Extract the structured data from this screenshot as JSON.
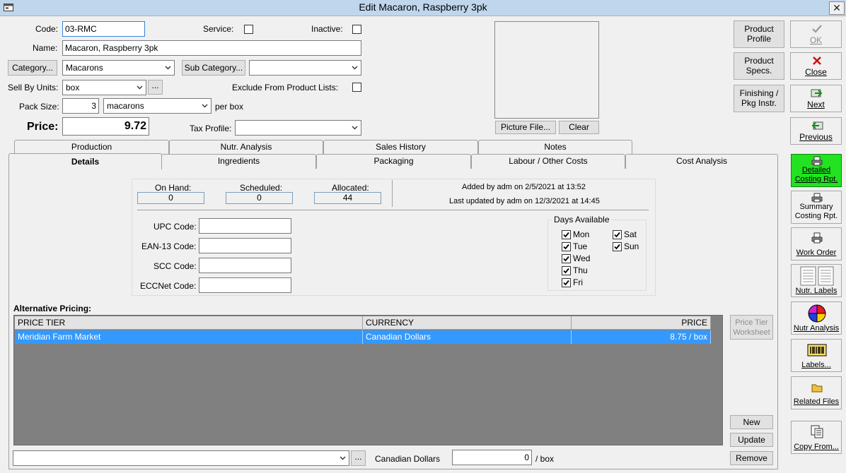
{
  "window": {
    "title": "Edit Macaron, Raspberry 3pk",
    "close_glyph": "✕"
  },
  "form": {
    "code_label": "Code:",
    "code_value": "03-RMC",
    "service_label": "Service:",
    "inactive_label": "Inactive:",
    "name_label": "Name:",
    "name_value": "Macaron, Raspberry 3pk",
    "category_button": "Category...",
    "category_value": "Macarons",
    "subcategory_button": "Sub Category...",
    "subcategory_value": "",
    "sell_by_label": "Sell By Units:",
    "sell_by_value": "box",
    "units_button": "...",
    "exclude_label": "Exclude From Product Lists:",
    "pack_size_label": "Pack Size:",
    "pack_size_value": "3",
    "pack_unit_value": "macarons",
    "per_box": "per box",
    "price_label": "Price:",
    "price_value": "9.72",
    "tax_profile_label": "Tax Profile:",
    "tax_profile_value": ""
  },
  "picture": {
    "file_button": "Picture File...",
    "clear_button": "Clear"
  },
  "product_buttons": {
    "profile": [
      "Product",
      "Profile"
    ],
    "specs": [
      "Product",
      "Specs."
    ],
    "finishing": [
      "Finishing /",
      "Pkg Instr."
    ]
  },
  "action_buttons": {
    "ok": "OK",
    "close": "Close",
    "next": "Next",
    "previous": "Previous"
  },
  "tabs_back": [
    "Production",
    "Nutr. Analysis",
    "Sales History",
    "Notes"
  ],
  "tabs_front": [
    "Details",
    "Ingredients",
    "Packaging",
    "Labour / Other Costs",
    "Cost Analysis"
  ],
  "stock": {
    "on_hand_label": "On Hand:",
    "on_hand": "0",
    "scheduled_label": "Scheduled:",
    "scheduled": "0",
    "allocated_label": "Allocated:",
    "allocated": "44",
    "added": "Added by adm on 2/5/2021 at 13:52",
    "updated": "Last updated by adm on 12/3/2021 at 14:45"
  },
  "codes": {
    "upc_label": "UPC Code:",
    "ean_label": "EAN-13 Code:",
    "scc_label": "SCC Code:",
    "eccnet_label": "ECCNet Code:"
  },
  "days": {
    "title": "Days Available",
    "list": [
      {
        "label": "Mon",
        "checked": true
      },
      {
        "label": "Tue",
        "checked": true
      },
      {
        "label": "Wed",
        "checked": true
      },
      {
        "label": "Thu",
        "checked": true
      },
      {
        "label": "Fri",
        "checked": true
      },
      {
        "label": "Sat",
        "checked": true
      },
      {
        "label": "Sun",
        "checked": true
      }
    ]
  },
  "alt_pricing": {
    "title": "Alternative Pricing:",
    "columns": [
      "PRICE TIER",
      "CURRENCY",
      "PRICE"
    ],
    "rows": [
      [
        "Meridian Farm Market",
        "Canadian Dollars",
        "8.75 / box"
      ]
    ],
    "worksheet_button": [
      "Price Tier",
      "Worksheet"
    ],
    "new_button": "New",
    "update_button": "Update",
    "remove_button": "Remove",
    "bottom_currency": "Canadian Dollars",
    "bottom_value": "0",
    "bottom_unit": "/ box",
    "ellipsis": "..."
  },
  "sidebar": {
    "detailed": [
      "Detailed",
      "Costing Rpt."
    ],
    "summary": [
      "Summary",
      "Costing Rpt."
    ],
    "work_order": "Work Order",
    "nutr_labels": "Nutr. Labels",
    "nutr_analysis": "Nutr Analysis",
    "labels": "Labels...",
    "related": "Related Files",
    "copy": "Copy From..."
  }
}
